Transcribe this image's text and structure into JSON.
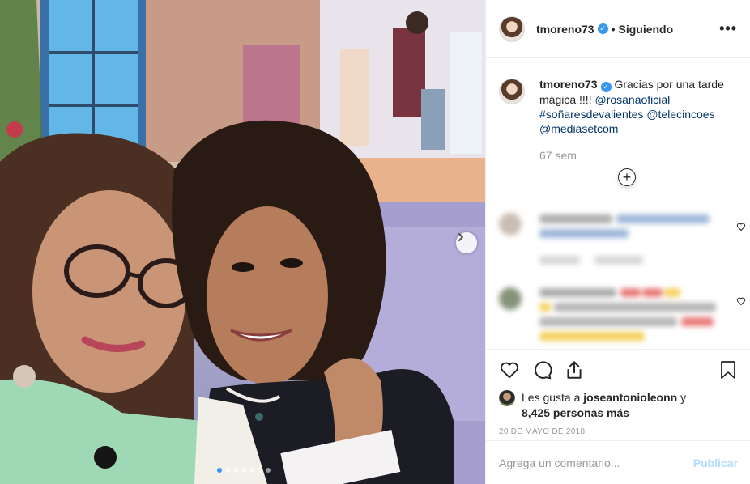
{
  "post": {
    "username": "tmoreno73",
    "follow_status": "Siguiendo",
    "separator": "•",
    "more_label": "•••"
  },
  "caption": {
    "username": "tmoreno73",
    "text": "Gracias por una tarde mágica !!!!",
    "mention_1": "@rosanaoficial",
    "hashtag": "#soñaresdevalientes",
    "mention_2": "@telecincoes",
    "mention_3": "@mediasetcom",
    "time": "67 sem"
  },
  "likes": {
    "prefix": "Les gusta a",
    "user": "joseantonioleonn",
    "connector": "y",
    "others": "8,425 personas más"
  },
  "date": "20 DE MAYO DE 2018",
  "comment_box": {
    "placeholder": "Agrega un comentario...",
    "publish_label": "Publicar"
  },
  "carousel": {
    "slides": 7,
    "active_slide": 1
  },
  "colors": {
    "verified": "#3897f0",
    "link": "#003569",
    "publish": "#b3dbff",
    "muted": "#999999"
  },
  "icons": [
    "heart-icon",
    "comment-icon",
    "share-icon",
    "bookmark-icon",
    "plus-circle-icon",
    "chevron-right-icon",
    "verified-badge-icon"
  ]
}
